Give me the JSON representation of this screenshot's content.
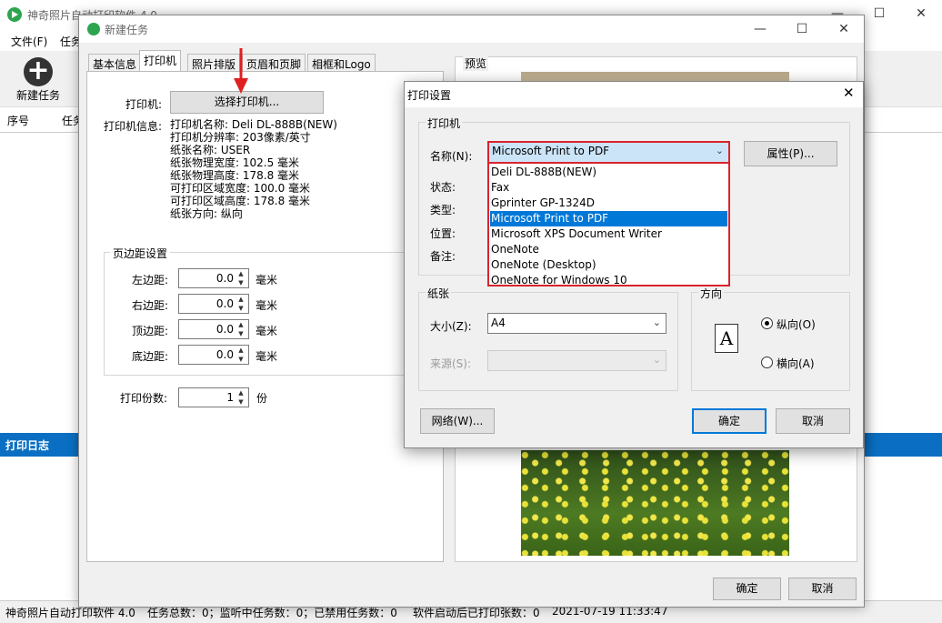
{
  "main": {
    "title": "神奇照片自动打印软件 4.0",
    "menu": [
      "文件(F)",
      "任务"
    ],
    "new_task_label": "新建任务",
    "grid_headers": [
      "序号",
      "任务"
    ],
    "log_title": "打印日志",
    "status": [
      "神奇照片自动打印软件 4.0",
      "任务总数：0；监听中任务数：0；已禁用任务数：0",
      "软件启动后已打印张数：0",
      "2021-07-19 11:33:47"
    ]
  },
  "new_task": {
    "title": "新建任务",
    "tabs": [
      "基本信息",
      "打印机",
      "照片排版",
      "页眉和页脚",
      "相框和Logo"
    ],
    "printer_label": "打印机:",
    "select_printer_button": "选择打印机...",
    "printer_info_label": "打印机信息:",
    "printer_info": [
      "打印机名称: Deli DL-888B(NEW)",
      "打印机分辨率: 203像素/英寸",
      "纸张名称: USER",
      "纸张物理宽度: 102.5 毫米",
      "纸张物理高度: 178.8 毫米",
      "可打印区域宽度: 100.0 毫米",
      "可打印区域高度: 178.8 毫米",
      "纸张方向: 纵向"
    ],
    "margin_group_title": "页边距设置",
    "margins": [
      {
        "label": "左边距:",
        "value": "0.0",
        "unit": "毫米"
      },
      {
        "label": "右边距:",
        "value": "0.0",
        "unit": "毫米"
      },
      {
        "label": "顶边距:",
        "value": "0.0",
        "unit": "毫米"
      },
      {
        "label": "底边距:",
        "value": "0.0",
        "unit": "毫米"
      }
    ],
    "copies_label": "打印份数:",
    "copies_value": "1",
    "copies_unit": "份",
    "preview_label": "预览",
    "ok_button": "确定",
    "cancel_button": "取消"
  },
  "print_dialog": {
    "title": "打印设置",
    "printer_group": "打印机",
    "name_label": "名称(N):",
    "selected_printer": "Microsoft Print to PDF",
    "properties_button": "属性(P)...",
    "status_label": "状态:",
    "type_label": "类型:",
    "location_label": "位置:",
    "comment_label": "备注:",
    "printer_options": [
      "Deli DL-888B(NEW)",
      "Fax",
      "Gprinter  GP-1324D",
      "Microsoft Print to PDF",
      "Microsoft XPS Document Writer",
      "OneNote",
      "OneNote (Desktop)",
      "OneNote for Windows 10"
    ],
    "selected_index": 3,
    "paper_group": "纸张",
    "size_label": "大小(Z):",
    "size_value": "A4",
    "source_label": "来源(S):",
    "orientation_group": "方向",
    "portrait_label": "纵向(O)",
    "landscape_label": "横向(A)",
    "network_button": "网络(W)...",
    "ok_button": "确定",
    "cancel_button": "取消"
  },
  "colors": {
    "accent": "#0078d7",
    "log_header": "#0a6fc2",
    "highlight_border": "#d9232d",
    "arrow": "#e02020"
  }
}
